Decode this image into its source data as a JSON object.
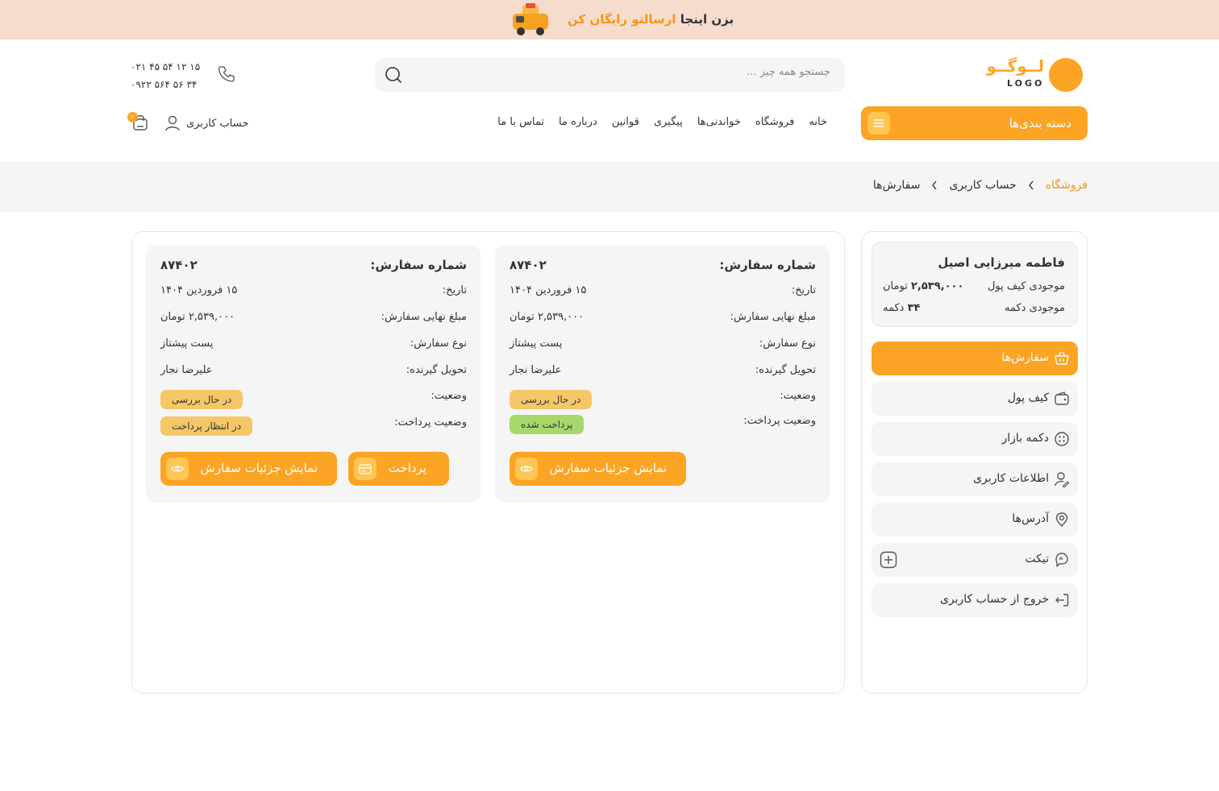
{
  "banner": {
    "prefix": "بزن اینجا",
    "highlight": "ارسالتو رایگان کن"
  },
  "header": {
    "logo_text": "لــوگــو",
    "logo_en": "LOGO",
    "search_placeholder": "جستجو همه چیز ...",
    "phones": [
      "۰۲۱ ۴۵ ۵۴ ۱۲ ۱۵",
      "۰۹۲۲ ۵۶۴ ۵۶ ۳۴"
    ],
    "categories_label": "دسته بندی‌ها",
    "menu": [
      "خانه",
      "فروشگاه",
      "خواندنی‌ها",
      "پیگیری",
      "قوانین",
      "درباره ما",
      "تماس با ما"
    ],
    "account_label": "حساب کاربری",
    "cart_count": "۲"
  },
  "breadcrumb": [
    "فروشگاه",
    "حساب کاربری",
    "سفارش‌ها"
  ],
  "sidebar": {
    "name": "فاطمه میرزایی اصیل",
    "wallet_label": "موجودی کیف پول",
    "wallet_amount": "۲,۵۳۹,۰۰۰",
    "wallet_unit": "تومان",
    "coins_label": "موجودی دکمه",
    "coins_amount": "۳۴",
    "coins_unit": "دکمه",
    "items": [
      {
        "label": "سفارش‌ها",
        "icon": "basket-icon",
        "active": true
      },
      {
        "label": "کیف پول",
        "icon": "wallet-icon"
      },
      {
        "label": "دکمه بازار",
        "icon": "button-icon"
      },
      {
        "label": "اطلاعات کاربری",
        "icon": "user-edit-icon"
      },
      {
        "label": "آدرس‌ها",
        "icon": "location-icon"
      },
      {
        "label": "تیکت",
        "icon": "ticket-icon"
      },
      {
        "label": "خروج از حساب کاربری",
        "icon": "logout-icon"
      }
    ]
  },
  "labels": {
    "order_no": "شماره سفارش:",
    "date": "تاریخ:",
    "amount": "مبلغ نهایی سفارش:",
    "type": "نوع سفارش:",
    "receiver": "تحویل گیرنده:",
    "status": "وضعیت:",
    "payment_status": "وضعیت پرداخت:",
    "details_button": "نمایش جزئیات سفارش",
    "pay_button": "پرداخت"
  },
  "orders": [
    {
      "number": "۸۷۴۰۲",
      "date": "۱۵ فروردین ۱۴۰۴",
      "amount": "۲,۵۳۹,۰۰۰ تومان",
      "type": "پست پیشتاز",
      "receiver": "علیرضا نجار",
      "status": "در حال بررسی",
      "payment_status": "پرداخت شده",
      "payment_color": "#a6d86c"
    },
    {
      "number": "۸۷۴۰۲",
      "date": "۱۵ فروردین ۱۴۰۴",
      "amount": "۲,۵۳۹,۰۰۰ تومان",
      "type": "پست پیشتاز",
      "receiver": "علیرضا نجار",
      "status": "در حال بررسی",
      "payment_status": "در انتظار پرداخت",
      "payment_color": "#f6c768"
    }
  ],
  "colors": {
    "accent": "#fca424",
    "banner_bg": "#f5dccd",
    "panel_bg": "#f5f5f5"
  }
}
